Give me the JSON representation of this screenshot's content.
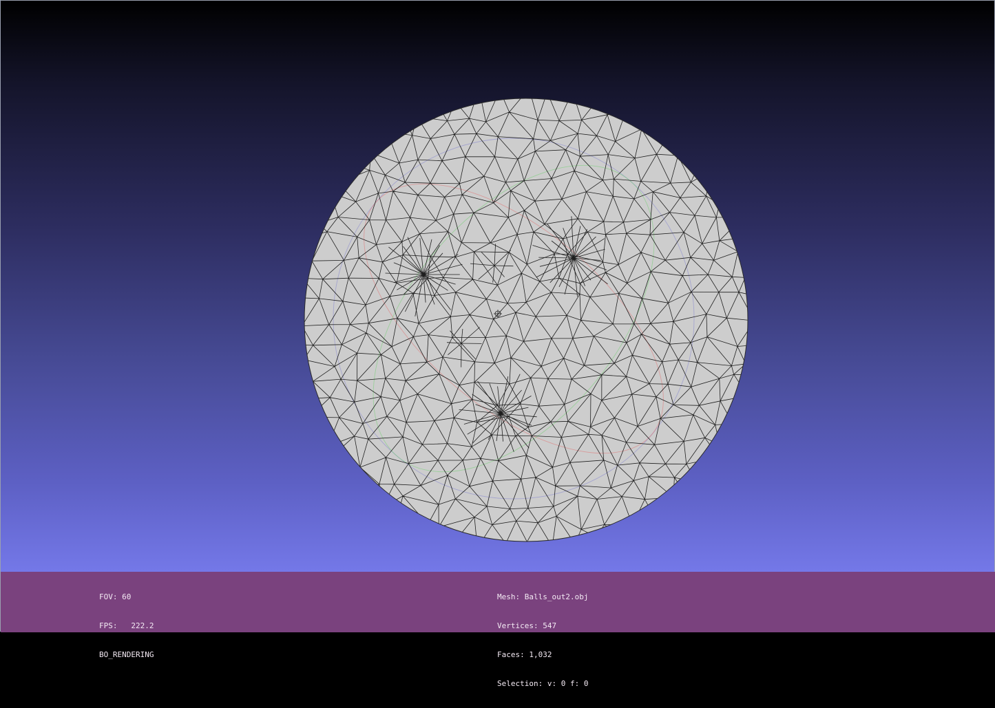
{
  "viewer": {
    "background_top": "#000000",
    "background_bottom": "#7478e8",
    "mesh_fill": "#cdcdcd",
    "wire_color": "#1e1e1e",
    "axis_colors": {
      "x": "#e07a7a",
      "y": "#7ad07a",
      "z": "#8a8ad0"
    }
  },
  "info_panel": {
    "background": "#7a427e",
    "left": {
      "fov": "FOV: 60",
      "fps": "FPS:   222.2",
      "mode": "BO_RENDERING"
    },
    "right": {
      "mesh": "Mesh: Balls_out2.obj",
      "vertices": "Vertices: 547",
      "faces": "Faces: 1,032",
      "selection": "Selection: v: 0 f: 0"
    }
  }
}
